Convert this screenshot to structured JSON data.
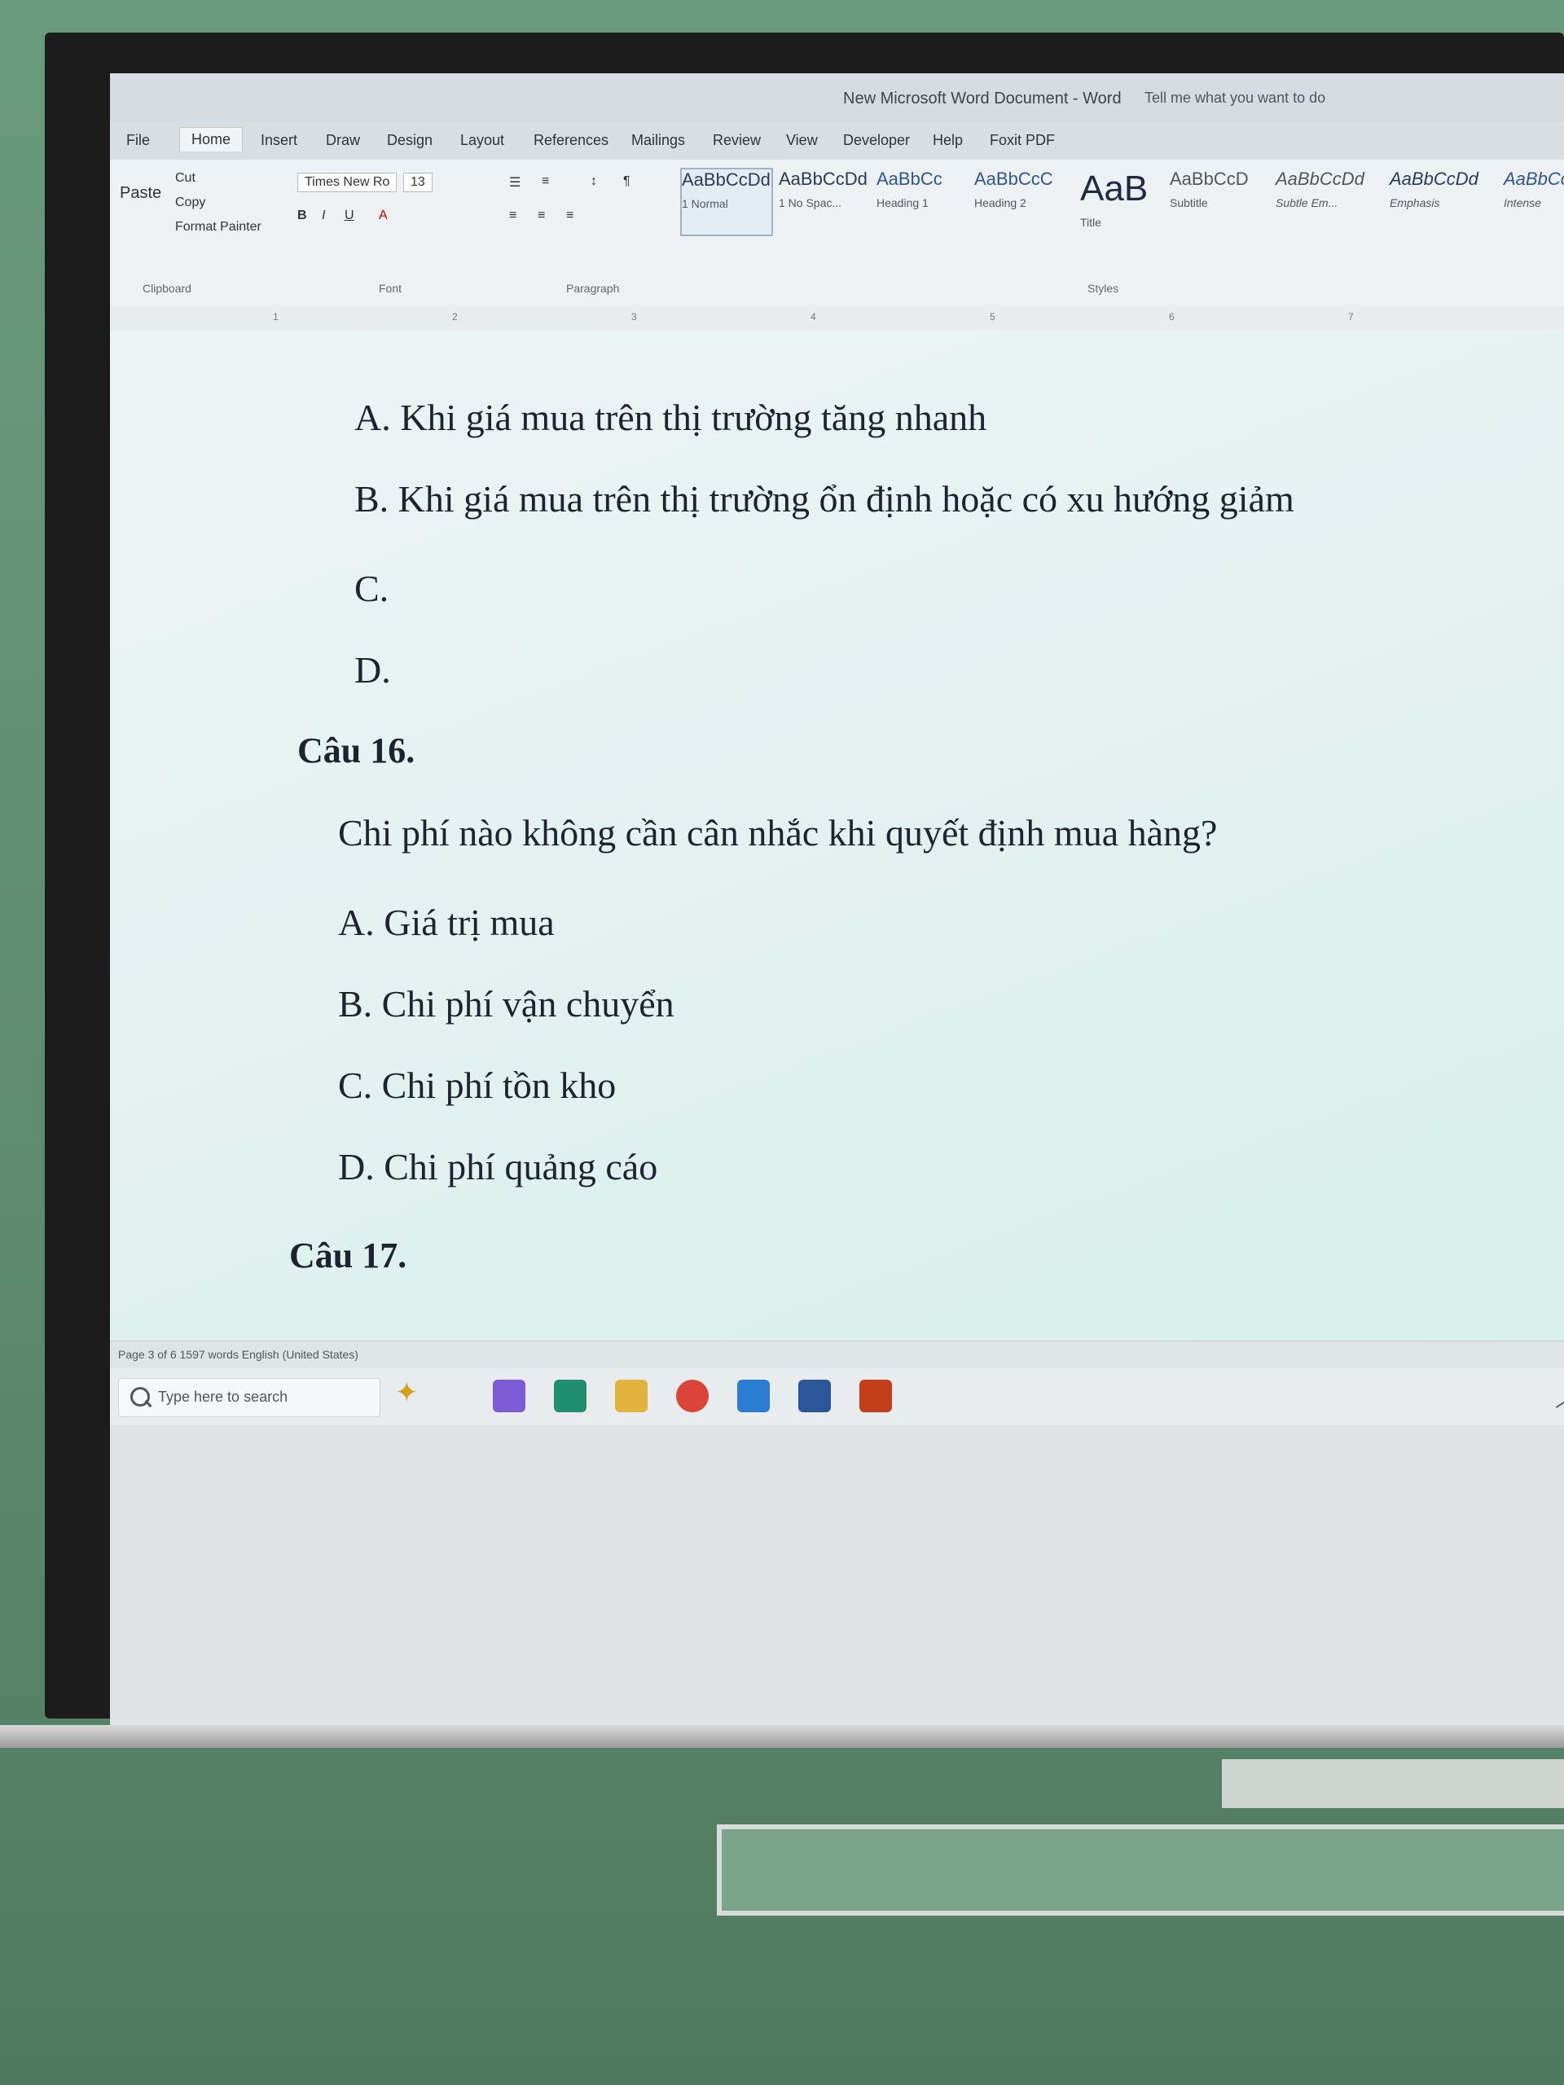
{
  "window": {
    "title": "New Microsoft Word Document - Word",
    "tell_me": "Tell me what you want to do"
  },
  "tabs": [
    "File",
    "Home",
    "Insert",
    "Draw",
    "Design",
    "Layout",
    "References",
    "Mailings",
    "Review",
    "View",
    "Developer",
    "Help",
    "Foxit PDF"
  ],
  "ribbon": {
    "clipboard": {
      "paste": "Paste",
      "cut": "Cut",
      "copy": "Copy",
      "format_painter": "Format Painter",
      "label": "Clipboard"
    },
    "font": {
      "name": "Times New Ro",
      "size": "13",
      "label": "Font"
    },
    "paragraph_label": "Paragraph",
    "styles": [
      {
        "preview": "AaBbCcDd",
        "name": "1 Normal",
        "selected": true
      },
      {
        "preview": "AaBbCcDd",
        "name": "1 No Spac..."
      },
      {
        "preview": "AaBbCc",
        "name": "Heading 1"
      },
      {
        "preview": "AaBbCcC",
        "name": "Heading 2"
      },
      {
        "preview": "AaB",
        "name": "Title"
      },
      {
        "preview": "AaBbCcD",
        "name": "Subtitle"
      },
      {
        "preview": "AaBbCcDd",
        "name": "Subtle Em..."
      },
      {
        "preview": "AaBbCcDd",
        "name": "Emphasis"
      },
      {
        "preview": "AaBbCcDd",
        "name": "Intense"
      }
    ],
    "styles_label": "Styles"
  },
  "document": {
    "lines": [
      {
        "text": "A. Khi giá mua trên thị trường tăng nhanh",
        "kind": "option"
      },
      {
        "text": "B. Khi giá mua trên thị trường ổn định hoặc có xu hướng giảm",
        "kind": "option"
      },
      {
        "text": "C.",
        "kind": "option"
      },
      {
        "text": "D.",
        "kind": "option"
      },
      {
        "text": "Câu 16.",
        "kind": "title"
      },
      {
        "text": "Chi phí nào không cần cân nhắc khi quyết định mua hàng?",
        "kind": "question"
      },
      {
        "text": "A. Giá trị mua",
        "kind": "option"
      },
      {
        "text": "B. Chi phí vận chuyển",
        "kind": "option"
      },
      {
        "text": "C. Chi phí tồn kho",
        "kind": "option"
      },
      {
        "text": "D. Chi phí quảng cáo",
        "kind": "option"
      },
      {
        "text": "Câu 17.",
        "kind": "title"
      }
    ]
  },
  "statusbar": {
    "text": "Page 3 of 6   1597 words   English (United States)"
  },
  "taskbar": {
    "search_placeholder": "Type here to search",
    "apps": [
      "copilot-icon",
      "edge-icon",
      "file-explorer-icon",
      "chrome-icon",
      "mail-icon",
      "word-icon",
      "powerpoint-icon"
    ],
    "app_colors": [
      "#7b5cd6",
      "#1f8f6f",
      "#e2b33c",
      "#db4437",
      "#2b7cd3",
      "#2b579a",
      "#c43e1c"
    ]
  }
}
